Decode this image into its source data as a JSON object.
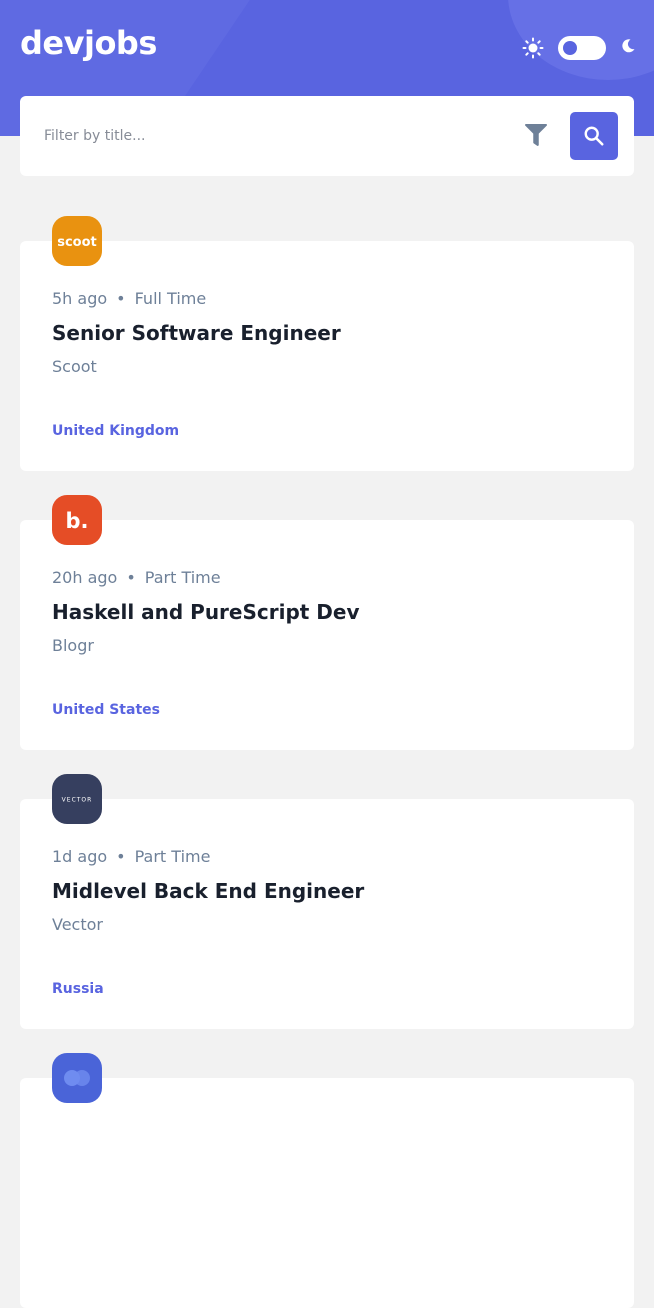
{
  "header": {
    "logo": "devjobs",
    "theme_toggle": {
      "state": "light"
    }
  },
  "search": {
    "placeholder": "Filter by title..."
  },
  "jobs": [
    {
      "posted_at": "5h ago",
      "contract": "Full Time",
      "position": "Senior Software Engineer",
      "company": "Scoot",
      "location": "United Kingdom",
      "logo_text": "scoot",
      "logo_background": "#e99210"
    },
    {
      "posted_at": "20h ago",
      "contract": "Part Time",
      "position": "Haskell and PureScript Dev",
      "company": "Blogr",
      "location": "United States",
      "logo_text": "b.",
      "logo_background": "#e54d26"
    },
    {
      "posted_at": "1d ago",
      "contract": "Part Time",
      "position": "Midlevel Back End Engineer",
      "company": "Vector",
      "location": "Russia",
      "logo_text": "VECTOR",
      "logo_background": "#363f5f"
    },
    {
      "logo_background": "#4a64d8"
    }
  ],
  "colors": {
    "accent": "#5964e0",
    "page_background": "#f2f2f2",
    "card_background": "#ffffff",
    "title": "#19202d",
    "muted": "#6e8098"
  }
}
